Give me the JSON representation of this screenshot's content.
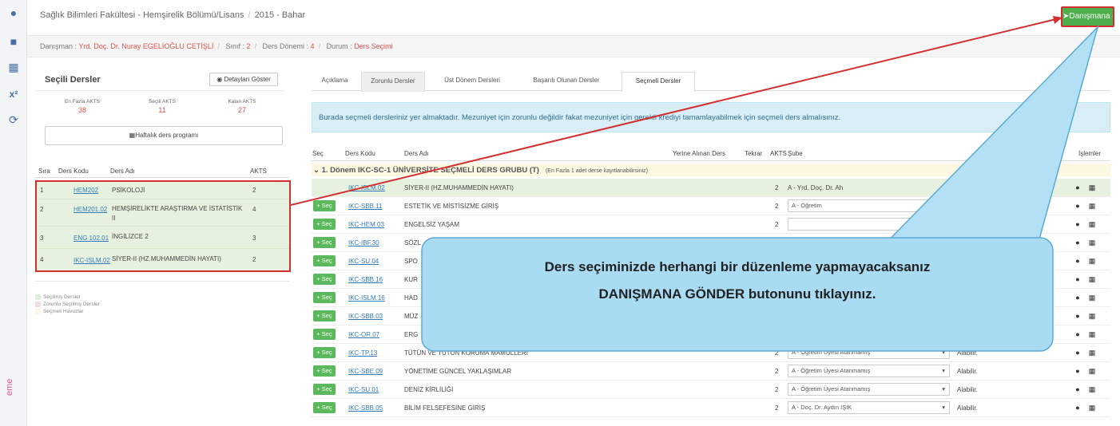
{
  "header": {
    "breadcrumb": [
      "Sağlık Bilimleri Fakültesi - Hemşirelik Bölümü/Lisans",
      "2015 - Bahar"
    ],
    "send_button": "Danışmana Gönder"
  },
  "subbar": {
    "advisor_label": "Danışman : ",
    "advisor_value": "Yrd. Doç. Dr. Nuray EGELİOĞLU CETİŞLİ",
    "class_label": "Sınıf : ",
    "class_value": "2",
    "term_label": "Ders Dönemi : ",
    "term_value": "4",
    "status_label": "Durum : ",
    "status_value": "Ders Seçimi"
  },
  "sidebar": {
    "side_label": "eme"
  },
  "left_panel": {
    "title": "Seçili Dersler",
    "detail_button": "Detayları Göster",
    "stats": [
      {
        "label": "En Fazla AKTS",
        "value": "38"
      },
      {
        "label": "Seçili AKTS",
        "value": "11"
      },
      {
        "label": "Kalan AKTS",
        "value": "27"
      }
    ],
    "weekly_button": "Haftalık ders programı",
    "table_headers": {
      "no": "Sıra",
      "code": "Ders Kodu",
      "name": "Ders Adı",
      "akts": "AKTS"
    },
    "rows": [
      {
        "no": "1",
        "code": "HEM202",
        "name": "PSİKOLOJİ",
        "akts": "2"
      },
      {
        "no": "2",
        "code": "HEM201.02",
        "name": "HEMŞİRELİKTE ARAŞTIRMA VE İSTATİSTİK",
        "name2": "II",
        "akts": "4"
      },
      {
        "no": "3",
        "code": "ENG 102.01",
        "name": "İNGİLİZCE 2",
        "akts": "3"
      },
      {
        "no": "4",
        "code": "IKC-ISLM.02",
        "name": "SİYER-II (HZ.MUHAMMEDİN HAYATI)",
        "akts": "2"
      }
    ],
    "legend": [
      {
        "label": "Seçilmiş Dersler",
        "color": "#dff0d8"
      },
      {
        "label": "Zorunlu Seçilmiş Dersler",
        "color": "#f2dede"
      },
      {
        "label": "Seçmeli Havuzlar",
        "color": "#fcf8e3"
      }
    ]
  },
  "tabs": [
    "Açıklama",
    "Zorunlu Dersler",
    "Üst Dönem Dersleri",
    "Başarılı Olunan Dersler",
    "Seçmeli Dersler"
  ],
  "info_text": "Burada seçmeli dersleriniz yer almaktadır. Mezuniyet için zorunlu değildir fakat mezuniyet için gerekli krediyi tamamlayabilmek için seçmeli ders almalısınız.",
  "table": {
    "headers": {
      "sec": "Seç",
      "code": "Ders Kodu",
      "name": "Ders Adı",
      "alt": "Yerine Alınan Ders",
      "repeat": "Tekrar",
      "akts": "AKTS",
      "branch": "Şube",
      "actions": "İşlemler"
    },
    "group_title": "⌄ 1. Dönem IKC-SC-1 ÜNİVERSİTE SEÇMELİ DERS GRUBU (T)",
    "group_note": "(En Fazla 1 adet derse kayıtlanabilirsiniz)",
    "select_label": "+ Seç",
    "rows": [
      {
        "code": "IKC-ISLM.02",
        "name": "SİYER-II (HZ.MUHAMMEDİN HAYATI)",
        "akts": "2",
        "branch": "A - Yrd. Doç. Dr. Ah",
        "status": "Alabilir.",
        "selected": true
      },
      {
        "code": "IKC-SBB.11",
        "name": "ESTETİK VE MİSTİSİZME GİRİŞ",
        "akts": "2",
        "branch": "A - Öğretim",
        "status": "Alabilir."
      },
      {
        "code": "IKC-HEM.03",
        "name": "ENGELSİZ YAŞAM",
        "akts": "2",
        "branch": "",
        "status": "Alabilir."
      },
      {
        "code": "IKC-IBF.30",
        "name": "SÖZL",
        "akts": "",
        "branch": "",
        "status": ""
      },
      {
        "code": "IKC-SU.04",
        "name": "SPO",
        "akts": "",
        "branch": "",
        "status": ""
      },
      {
        "code": "IKC-SBB.16",
        "name": "KUR",
        "akts": "",
        "branch": "",
        "status": ""
      },
      {
        "code": "IKC-ISLM.16",
        "name": "HAD",
        "akts": "",
        "branch": "",
        "status": ""
      },
      {
        "code": "IKC-SBB.03",
        "name": "MÜZ",
        "akts": "",
        "branch": "",
        "status": ""
      },
      {
        "code": "IKC-OR.07",
        "name": "ERG",
        "akts": "",
        "branch": "",
        "status": ""
      },
      {
        "code": "IKC-TP.13",
        "name": "TÜTÜN VE TÜTÜN KORUMA MAMULLERİ",
        "akts": "2",
        "branch": "A - Öğretim Üyesi Atanmamış",
        "status": "Alabilir."
      },
      {
        "code": "IKC-SBE.09",
        "name": "YÖNETİME GÜNCEL YAKLAŞIMLAR",
        "akts": "2",
        "branch": "A - Öğretim Üyesi Atanmamış",
        "status": "Alabilir."
      },
      {
        "code": "IKC-SU.01",
        "name": "DENİZ KİRLİLİĞİ",
        "akts": "2",
        "branch": "A - Öğretim Üyesi Atanmamış",
        "status": "Alabilir."
      },
      {
        "code": "IKC-SBB.05",
        "name": "BİLİM FELSEFESİNE GİRİŞ",
        "akts": "2",
        "branch": "A - Doç. Dr. Aydın IŞIK",
        "status": "Alabilir."
      }
    ]
  },
  "callout": {
    "line1": "Ders seçiminizde herhangi bir düzenleme yapmayacaksanız",
    "line2": "DANIŞMANA GÖNDER butonunu tıklayınız."
  },
  "colors": {
    "accent_green": "#5cb85c",
    "highlight_red": "#d32f2f",
    "callout_fill": "#a9dcf3",
    "selected_row": "#e6f2df"
  }
}
